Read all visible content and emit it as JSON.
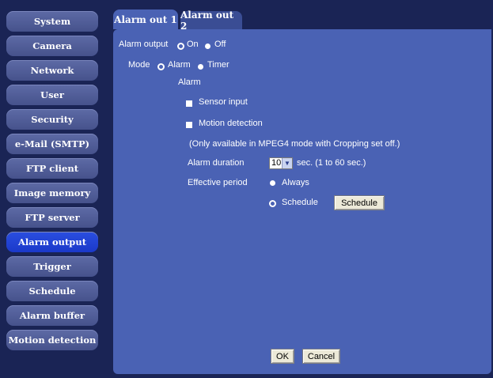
{
  "sidebar": {
    "items": [
      {
        "label": "System"
      },
      {
        "label": "Camera"
      },
      {
        "label": "Network"
      },
      {
        "label": "User"
      },
      {
        "label": "Security"
      },
      {
        "label": "e-Mail (SMTP)"
      },
      {
        "label": "FTP client"
      },
      {
        "label": "Image memory"
      },
      {
        "label": "FTP server"
      },
      {
        "label": "Alarm output",
        "active": true
      },
      {
        "label": "Trigger"
      },
      {
        "label": "Schedule"
      },
      {
        "label": "Alarm buffer"
      },
      {
        "label": "Motion detection"
      }
    ]
  },
  "tabs": [
    {
      "label": "Alarm out 1",
      "active": true
    },
    {
      "label": "Alarm out 2",
      "active": false
    }
  ],
  "form": {
    "alarm_output_label": "Alarm output",
    "alarm_output_on": "On",
    "alarm_output_off": "Off",
    "alarm_output_selected": "On",
    "mode_label": "Mode",
    "mode_alarm": "Alarm",
    "mode_timer": "Timer",
    "mode_selected": "Alarm",
    "alarm_section": "Alarm",
    "sensor_input": "Sensor input",
    "sensor_input_checked": false,
    "motion_detection": "Motion detection",
    "motion_detection_checked": false,
    "motion_note": "(Only available in MPEG4 mode with Cropping set off.)",
    "alarm_duration_label": "Alarm duration",
    "alarm_duration_value": "10",
    "alarm_duration_unit": "sec. (1 to 60 sec.)",
    "effective_period_label": "Effective period",
    "period_always": "Always",
    "period_schedule": "Schedule",
    "period_selected": "Schedule",
    "schedule_button": "Schedule"
  },
  "footer": {
    "ok": "OK",
    "cancel": "Cancel"
  },
  "colors": {
    "background": "#1a2455",
    "panel": "#4a62b4",
    "sidebar_button": "#46528c",
    "sidebar_active": "#1b39c9"
  }
}
